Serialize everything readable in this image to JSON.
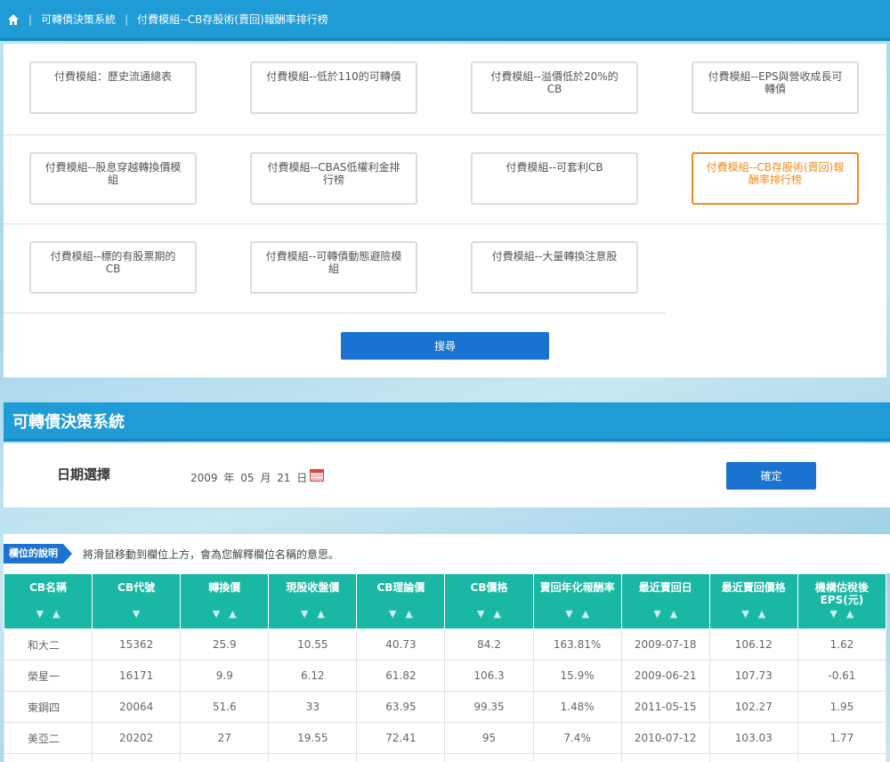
{
  "topbar": {
    "crumb1": "可轉債決策系統",
    "crumb2": "付費模組--CB存股術(賣回)報酬率排行榜"
  },
  "modules": [
    {
      "label": "付費模組：歷史流通總表",
      "active": false
    },
    {
      "label": "付費模組--低於110的可轉債",
      "active": false
    },
    {
      "label": "付費模組--溢價低於20%的CB",
      "active": false
    },
    {
      "label": "付費模組--EPS與營收成長可轉債",
      "active": false
    },
    {
      "label": "付費模組--股息穿越轉換價模組",
      "active": false
    },
    {
      "label": "付費模組--CBAS低權利金排行榜",
      "active": false
    },
    {
      "label": "付費模組--可套利CB",
      "active": false
    },
    {
      "label": "付費模組--CB存股術(賣回)報酬率排行榜",
      "active": true
    },
    {
      "label": "付費模組--標的有股票期的CB",
      "active": false
    },
    {
      "label": "付費模組--可轉債動態避險模組",
      "active": false
    },
    {
      "label": "付費模組--大量轉換注意股",
      "active": false
    }
  ],
  "search_label": "搜尋",
  "system_title": "可轉債決策系統",
  "date": {
    "label": "日期選擇",
    "year": "2009",
    "y_unit": "年",
    "month": "05",
    "m_unit": "月",
    "day": "21",
    "d_unit": "日",
    "confirm": "確定"
  },
  "explain": {
    "tag": "欄位的說明",
    "text": "將滑鼠移動到欄位上方，會為您解釋欄位名稱的意思。"
  },
  "table": {
    "sort_down": "▼",
    "sort_up": "▲",
    "columns": [
      {
        "label": "CB名稱",
        "sorts": [
          "down",
          "up"
        ]
      },
      {
        "label": "CB代號",
        "sorts": [
          "down"
        ]
      },
      {
        "label": "轉換價",
        "sorts": [
          "down",
          "up"
        ]
      },
      {
        "label": "現股收盤價",
        "sorts": [
          "down",
          "up"
        ]
      },
      {
        "label": "CB理論價",
        "sorts": [
          "down",
          "up"
        ]
      },
      {
        "label": "CB價格",
        "sorts": [
          "down",
          "up"
        ]
      },
      {
        "label": "賣回年化報酬率",
        "sorts": [
          "down",
          "up"
        ]
      },
      {
        "label": "最近賣回日",
        "sorts": [
          "down",
          "up"
        ]
      },
      {
        "label": "最近賣回價格",
        "sorts": [
          "down",
          "up"
        ]
      },
      {
        "label": "機構估稅後EPS(元)",
        "sorts": [
          "down",
          "up"
        ]
      }
    ],
    "rows": [
      [
        "和大二",
        "15362",
        "25.9",
        "10.55",
        "40.73",
        "84.2",
        "163.81%",
        "2009-07-18",
        "106.12",
        "1.62"
      ],
      [
        "榮星一",
        "16171",
        "9.9",
        "6.12",
        "61.82",
        "106.3",
        "15.9%",
        "2009-06-21",
        "107.73",
        "-0.61"
      ],
      [
        "東鋼四",
        "20064",
        "51.6",
        "33",
        "63.95",
        "99.35",
        "1.48%",
        "2011-05-15",
        "102.27",
        "1.95"
      ],
      [
        "美亞二",
        "20202",
        "27",
        "19.55",
        "72.41",
        "95",
        "7.4%",
        "2010-07-12",
        "103.03",
        "1.77"
      ],
      [
        "",
        "",
        "",
        "",
        "",
        "",
        "",
        "",
        "",
        ""
      ]
    ]
  },
  "colors": {
    "header_blue": "#1f9bd6",
    "button_blue": "#1a73d1",
    "table_teal": "#19b7a4",
    "active_orange": "#f08c1e"
  }
}
